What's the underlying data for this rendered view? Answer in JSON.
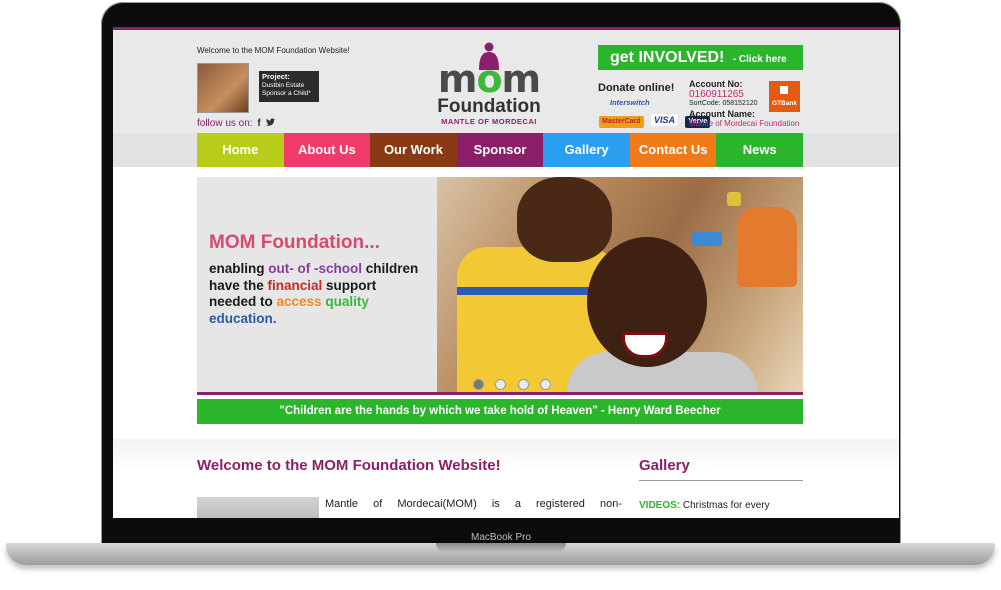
{
  "device": {
    "label": "MacBook Pro"
  },
  "header": {
    "welcome": "Welcome to the MOM Foundation Website!",
    "project": {
      "title": "Project:",
      "line1": "Dustbin Estate",
      "line2": "Sponsor a Child*"
    },
    "follow": "follow us on:",
    "social_icons": [
      "facebook-icon",
      "twitter-icon"
    ],
    "logo": {
      "mom_pre": "m",
      "mom_o": "o",
      "mom_post": "m",
      "foundation": "Foundation",
      "mantle": "MANTLE OF MORDECAI"
    },
    "involved": {
      "label": "get INVOLVED!",
      "click": "- Click here"
    },
    "donate": {
      "title": "Donate online!",
      "interswitch": "Interswitch",
      "cards": [
        "MasterCard",
        "VISA",
        "Verve"
      ]
    },
    "account": {
      "no_label": "Account No:",
      "no": "0160911265",
      "sortcode": "SortCode: 058152120",
      "name_label": "Account Name:",
      "name": "Mantle of Mordecai Foundation",
      "bank": "GTBank"
    }
  },
  "nav": {
    "items": [
      {
        "label": "Home",
        "color": "#b8cc1a"
      },
      {
        "label": "About Us",
        "color": "#f03a6a"
      },
      {
        "label": "Our Work",
        "color": "#8a3a12"
      },
      {
        "label": "Sponsor",
        "color": "#8b1f6a"
      },
      {
        "label": "Gallery",
        "color": "#2a9ef0"
      },
      {
        "label": "Contact Us",
        "color": "#f07a1a"
      },
      {
        "label": "News",
        "color": "#2ab52a"
      }
    ]
  },
  "hero": {
    "title": "MOM Foundation...",
    "line1_a": "enabling ",
    "line1_b": "out- of -school",
    "line1_c": " children",
    "line2_a": "have the ",
    "line2_b": "financial",
    "line2_c": " support",
    "line3_a": "needed to ",
    "line3_b": "access",
    "line3_c": " ",
    "line3_d": "quality",
    "line4": "education.",
    "slides": 4,
    "active_slide": 1
  },
  "quote": "\"Children are the hands by which we take hold of Heaven\" - Henry Ward Beecher",
  "content": {
    "welcome_heading": "Welcome to the MOM Foundation Website!",
    "intro": "Mantle of Mordecai(MOM) is a registered non-",
    "gallery_heading": "Gallery",
    "videos_label": "VIDEOS:",
    "videos_text": " Christmas for every"
  },
  "colors": {
    "purple": "#8b1f6a",
    "green": "#2ab52a",
    "pink": "#c42a73"
  }
}
